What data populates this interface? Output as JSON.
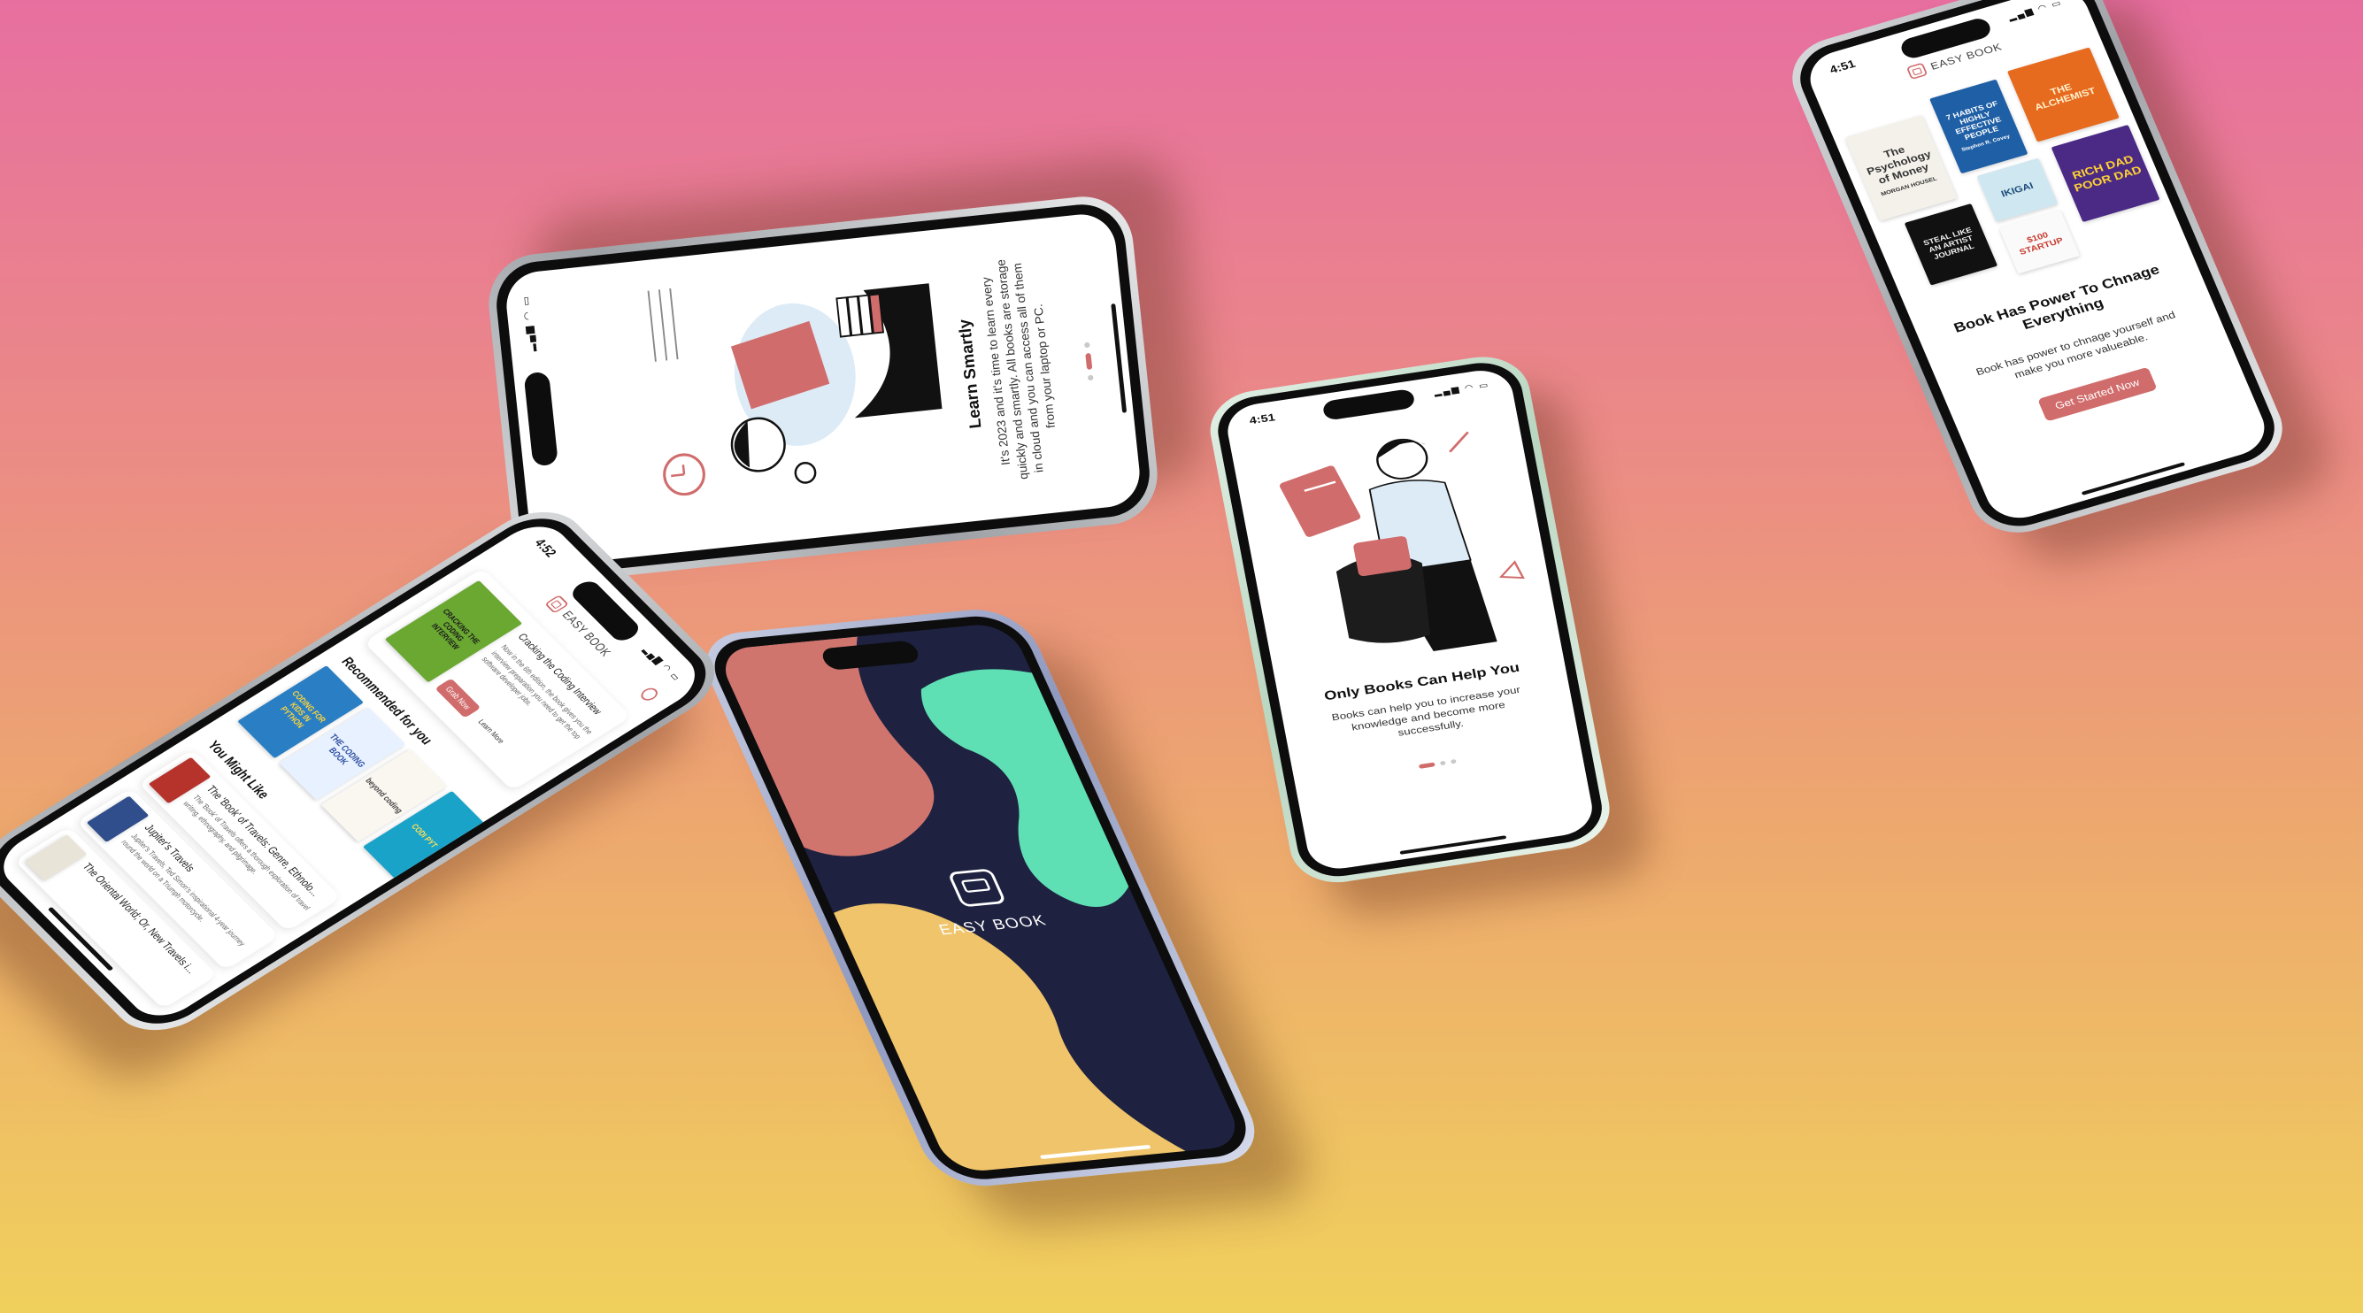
{
  "status": {
    "time_a": "4:51",
    "time_b": "4:52"
  },
  "brand": {
    "name": "EASY BOOK"
  },
  "onboarding": [
    {
      "title": "Learn Smartly",
      "description": "It's 2023 and it's time to learn every quickly and smartly. All books are storage in cloud and you can access all of them from your laptop or PC."
    },
    {
      "title": "Only Books Can Help You",
      "description": "Books can help you to increase your knowledge and become more successfully."
    },
    {
      "title": "Book Has Power To Chnage Everything",
      "description": "Book has power to chnage yourself and make you more valueable.",
      "button": "Get Started Now"
    }
  ],
  "covers": {
    "money": "The Psychology of Money",
    "money_author": "MORGAN HOUSEL",
    "habits": "7 HABITS OF HIGHLY EFFECTIVE PEOPLE",
    "habits_author": "Stephen R. Covey",
    "alchemist": "THE ALCHEMIST",
    "ikigai": "IKIGAI",
    "steal": "STEAL LIKE AN ARTIST JOURNAL",
    "startup": "$100 STARTUP",
    "richdad": "RICH DAD POOR DAD",
    "cracking": "CRACKING THE CODING INTERVIEW",
    "coding_kids": "CODING FOR KIDS IN PYTHON",
    "coding_book": "THE CODING BOOK",
    "beyond": "beyond coding",
    "coding_tail": "CODI PYT"
  },
  "home": {
    "featured": {
      "title": "Cracking the Coding Interview",
      "blurb": "Now in the 6th edition, the book gives you the interview preparation you need to get the top software developer jobs.",
      "grab": "Grab Now",
      "learn": "Learn More"
    },
    "recommended_label": "Recommended for you",
    "might_like_label": "You Might Like",
    "list": [
      {
        "title": "The 'Book' of Travels: Genre, Ethnolo...",
        "blurb": "The 'Book' of Travels offers a thorough exploration of travel writing, ethnography, and pilgrimage."
      },
      {
        "title": "Jupiter's Travels",
        "blurb": "Jupiter's Travels, Ted Simon's inspirational 4-year journey round the world on a Triumph motorcycle."
      },
      {
        "title": "The Oriental World; Or, New Travels i...",
        "blurb": ""
      }
    ]
  }
}
